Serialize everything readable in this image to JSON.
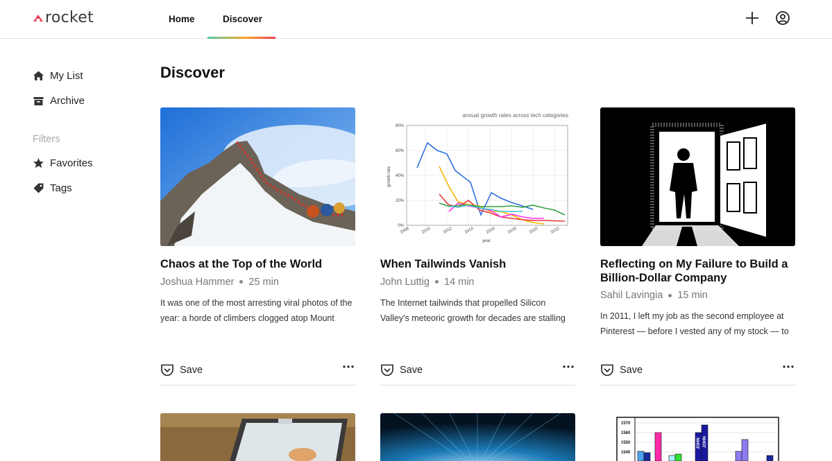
{
  "app": {
    "logo_text": "rocket"
  },
  "nav": {
    "tabs": [
      {
        "label": "Home"
      },
      {
        "label": "Discover"
      }
    ]
  },
  "sidebar": {
    "items": [
      {
        "label": "My List",
        "icon": "home-icon"
      },
      {
        "label": "Archive",
        "icon": "archive-icon"
      }
    ],
    "filters_label": "Filters",
    "filters": [
      {
        "label": "Favorites",
        "icon": "star-icon"
      },
      {
        "label": "Tags",
        "icon": "tag-icon"
      }
    ]
  },
  "main": {
    "title": "Discover",
    "cards": [
      {
        "title": "Chaos at the Top of the World",
        "author": "Joshua Hammer",
        "read_time": "25 min",
        "excerpt": "It was one of the most arresting viral photos of the year: a horde of climbers clogged atop Mount",
        "save_label": "Save"
      },
      {
        "title": "When Tailwinds Vanish",
        "author": "John Luttig",
        "read_time": "14 min",
        "excerpt": "The Internet tailwinds that propelled Silicon Valley's meteoric growth for decades are stalling",
        "save_label": "Save",
        "thumbnail_chart": {
          "title": "annual growth rates across tech categories",
          "xlabel": "year",
          "ylabel": "growth rate",
          "y_ticks": [
            "80%",
            "60%",
            "40%",
            "20%",
            "0%"
          ],
          "x_ticks": [
            "2008",
            "2010",
            "2012",
            "2014",
            "2016",
            "2018",
            "2020",
            "2022"
          ]
        }
      },
      {
        "title": "Reflecting on My Failure to Build a Billion-Dollar Company",
        "author": "Sahil Lavingia",
        "read_time": "15 min",
        "excerpt": "In 2011, I left my job as the second employee at Pinterest — before I vested any of my stock — to",
        "save_label": "Save"
      }
    ],
    "bottom_thumbnail": {
      "y_ticks": [
        "1570",
        "1560",
        "1550",
        "1540"
      ],
      "labels": [
        "JOHN",
        "JOHN"
      ]
    }
  },
  "colors": {
    "brand": "#ef4056",
    "accent_gradient": [
      "#52c9a6",
      "#f5a623",
      "#ef4056"
    ]
  }
}
